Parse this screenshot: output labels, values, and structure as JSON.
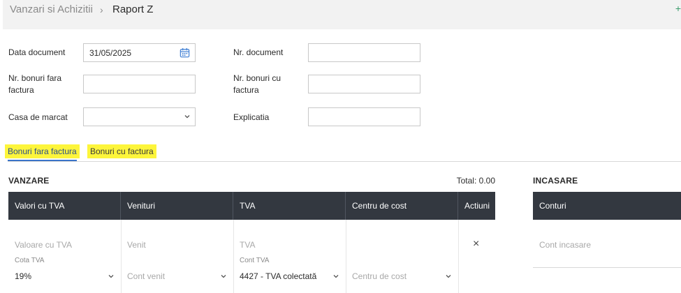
{
  "breadcrumb": {
    "parent": "Vanzari si Achizitii",
    "separator": "›",
    "current": "Raport Z",
    "right_action": "+"
  },
  "form": {
    "data_document": {
      "label": "Data document",
      "value": "31/05/2025"
    },
    "nr_document": {
      "label": "Nr. document",
      "value": ""
    },
    "nr_bonuri_fara": {
      "label": "Nr. bonuri fara factura",
      "value": ""
    },
    "nr_bonuri_cu": {
      "label": "Nr. bonuri cu factura",
      "value": ""
    },
    "casa_marcat": {
      "label": "Casa de marcat",
      "value": ""
    },
    "explicatia": {
      "label": "Explicatia",
      "value": ""
    }
  },
  "tabs": [
    {
      "label": "Bonuri fara factura",
      "active": true
    },
    {
      "label": "Bonuri cu factura",
      "active": false
    }
  ],
  "vanzare": {
    "title": "VANZARE",
    "total": "Total: 0.00",
    "columns": [
      "Valori cu TVA",
      "Venituri",
      "TVA",
      "Centru de cost",
      "Actiuni"
    ],
    "row": {
      "valoare_placeholder": "Valoare cu TVA",
      "venit_placeholder": "Venit",
      "tva_placeholder": "TVA",
      "cota_label": "Cota TVA",
      "cota_value": "19%",
      "cont_venit_placeholder": "Cont venit",
      "cont_tva_label": "Cont TVA",
      "cont_tva_value": "4427 - TVA colectată",
      "centru_placeholder": "Centru de cost",
      "remove_icon": "×"
    }
  },
  "incasare": {
    "title": "INCASARE",
    "columns": [
      "Conturi"
    ],
    "row": {
      "cont_placeholder": "Cont incasare"
    }
  },
  "colors": {
    "header_bg": "#333840",
    "highlight": "#fdf53b",
    "active_tab": "#3b74c7",
    "calendar_icon": "#4a86d6"
  }
}
